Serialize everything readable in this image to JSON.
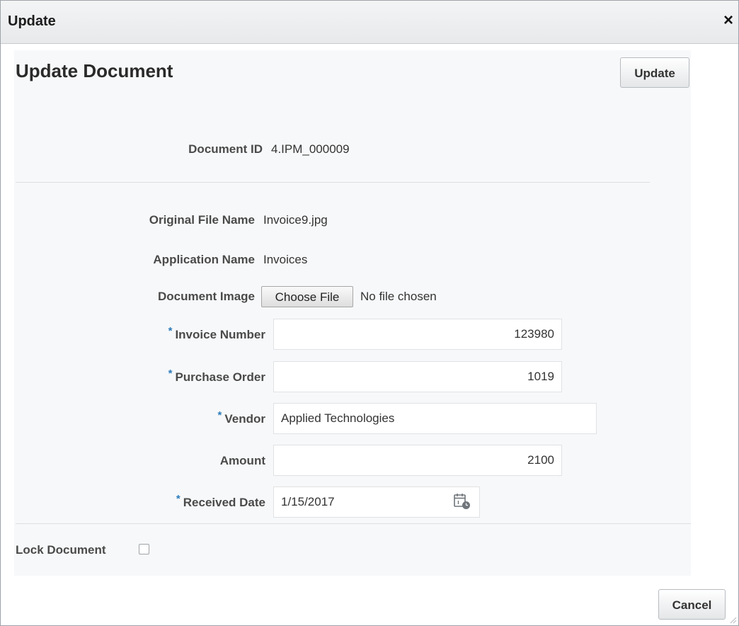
{
  "dialog": {
    "title": "Update",
    "close_glyph": "×",
    "cancel_label": "Cancel"
  },
  "panel": {
    "title": "Update Document",
    "update_label": "Update"
  },
  "fields": {
    "document_id": {
      "label": "Document ID",
      "value": "4.IPM_000009"
    },
    "original_file_name": {
      "label": "Original File Name",
      "value": "Invoice9.jpg"
    },
    "application_name": {
      "label": "Application Name",
      "value": "Invoices"
    },
    "document_image": {
      "label": "Document Image",
      "button": "Choose File",
      "status": "No file chosen"
    },
    "invoice_number": {
      "label": "Invoice Number",
      "value": "123980",
      "required": "*"
    },
    "purchase_order": {
      "label": "Purchase Order",
      "value": "1019",
      "required": "*"
    },
    "vendor": {
      "label": "Vendor",
      "value": "Applied Technologies",
      "required": "*"
    },
    "amount": {
      "label": "Amount",
      "value": "2100"
    },
    "received_date": {
      "label": "Received Date",
      "value": "1/15/2017",
      "required": "*"
    },
    "lock_document": {
      "label": "Lock Document",
      "checked": false
    }
  },
  "icons": {
    "close": "close-icon",
    "calendar": "calendar-icon",
    "resize": "resize-grip-icon"
  },
  "colors": {
    "required_marker": "#2d7cbb",
    "panel_background": "#f7f8f9",
    "titlebar_background": "#e7e9eb"
  }
}
